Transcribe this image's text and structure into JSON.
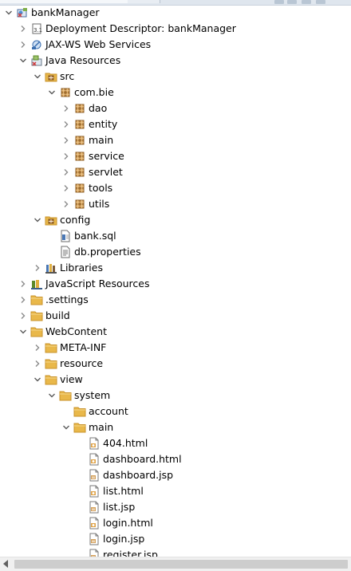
{
  "tree": [
    {
      "label": "bankManager",
      "depth": 0,
      "twisty": "open",
      "icon": "project-icon",
      "bold": false
    },
    {
      "label": "Deployment Descriptor: bankManager",
      "depth": 1,
      "twisty": "closed",
      "icon": "deployment-descriptor-icon"
    },
    {
      "label": "JAX-WS Web Services",
      "depth": 1,
      "twisty": "closed",
      "icon": "web-services-icon"
    },
    {
      "label": "Java Resources",
      "depth": 1,
      "twisty": "open",
      "icon": "java-resources-icon"
    },
    {
      "label": "src",
      "depth": 2,
      "twisty": "open",
      "icon": "source-folder-icon"
    },
    {
      "label": "com.bie",
      "depth": 3,
      "twisty": "open",
      "icon": "package-icon"
    },
    {
      "label": "dao",
      "depth": 4,
      "twisty": "closed",
      "icon": "package-icon"
    },
    {
      "label": "entity",
      "depth": 4,
      "twisty": "closed",
      "icon": "package-icon"
    },
    {
      "label": "main",
      "depth": 4,
      "twisty": "closed",
      "icon": "package-icon"
    },
    {
      "label": "service",
      "depth": 4,
      "twisty": "closed",
      "icon": "package-icon"
    },
    {
      "label": "servlet",
      "depth": 4,
      "twisty": "closed",
      "icon": "package-icon"
    },
    {
      "label": "tools",
      "depth": 4,
      "twisty": "closed",
      "icon": "package-icon"
    },
    {
      "label": "utils",
      "depth": 4,
      "twisty": "closed",
      "icon": "package-icon"
    },
    {
      "label": "config",
      "depth": 2,
      "twisty": "open",
      "icon": "source-folder-icon"
    },
    {
      "label": "bank.sql",
      "depth": 3,
      "twisty": "none",
      "icon": "sql-file-icon"
    },
    {
      "label": "db.properties",
      "depth": 3,
      "twisty": "none",
      "icon": "properties-file-icon"
    },
    {
      "label": "Libraries",
      "depth": 2,
      "twisty": "closed",
      "icon": "libraries-icon"
    },
    {
      "label": "JavaScript Resources",
      "depth": 1,
      "twisty": "closed",
      "icon": "javascript-resources-icon"
    },
    {
      "label": ".settings",
      "depth": 1,
      "twisty": "closed",
      "icon": "folder-icon"
    },
    {
      "label": "build",
      "depth": 1,
      "twisty": "closed",
      "icon": "folder-icon"
    },
    {
      "label": "WebContent",
      "depth": 1,
      "twisty": "open",
      "icon": "folder-icon"
    },
    {
      "label": "META-INF",
      "depth": 2,
      "twisty": "closed",
      "icon": "folder-icon"
    },
    {
      "label": "resource",
      "depth": 2,
      "twisty": "closed",
      "icon": "folder-icon"
    },
    {
      "label": "view",
      "depth": 2,
      "twisty": "open",
      "icon": "folder-icon"
    },
    {
      "label": "system",
      "depth": 3,
      "twisty": "open",
      "icon": "folder-icon"
    },
    {
      "label": "account",
      "depth": 4,
      "twisty": "none",
      "icon": "folder-icon"
    },
    {
      "label": "main",
      "depth": 4,
      "twisty": "open",
      "icon": "folder-icon"
    },
    {
      "label": "404.html",
      "depth": 5,
      "twisty": "none",
      "icon": "html-file-icon"
    },
    {
      "label": "dashboard.html",
      "depth": 5,
      "twisty": "none",
      "icon": "html-file-icon"
    },
    {
      "label": "dashboard.jsp",
      "depth": 5,
      "twisty": "none",
      "icon": "jsp-file-icon"
    },
    {
      "label": "list.html",
      "depth": 5,
      "twisty": "none",
      "icon": "html-file-icon"
    },
    {
      "label": "list.jsp",
      "depth": 5,
      "twisty": "none",
      "icon": "jsp-file-icon"
    },
    {
      "label": "login.html",
      "depth": 5,
      "twisty": "none",
      "icon": "html-file-icon"
    },
    {
      "label": "login.jsp",
      "depth": 5,
      "twisty": "none",
      "icon": "jsp-file-icon"
    },
    {
      "label": "register.jsp",
      "depth": 5,
      "twisty": "none",
      "icon": "jsp-file-icon"
    }
  ],
  "colors": {
    "folder": "#e9b84a",
    "package": "#b27a3a",
    "twisty": "#5a5a5a",
    "scrollbar_track": "#f0f0f0",
    "scrollbar_thumb": "#cdcdcd"
  }
}
